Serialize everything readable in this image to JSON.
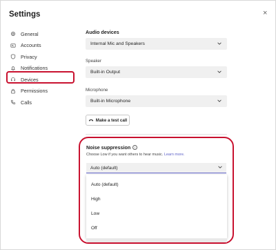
{
  "title": "Settings",
  "close_glyph": "×",
  "nav": [
    {
      "label": "General",
      "icon": "gear-icon"
    },
    {
      "label": "Accounts",
      "icon": "id-card-icon"
    },
    {
      "label": "Privacy",
      "icon": "shield-icon"
    },
    {
      "label": "Notifications",
      "icon": "bell-icon"
    },
    {
      "label": "Devices",
      "icon": "headset-icon"
    },
    {
      "label": "Permissions",
      "icon": "lock-icon"
    },
    {
      "label": "Calls",
      "icon": "phone-icon"
    }
  ],
  "audio": {
    "heading": "Audio devices",
    "device": "Internal Mic and Speakers",
    "speaker_label": "Speaker",
    "speaker": "Built-in Output",
    "mic_label": "Microphone",
    "mic": "Built-in Microphone",
    "test_call": "Make a test call"
  },
  "noise": {
    "heading": "Noise suppression",
    "info_glyph": "i",
    "description": "Choose Low if you want others to hear music.",
    "learn_more": "Learn more.",
    "selected": "Auto (default)",
    "options": [
      "Auto (default)",
      "High",
      "Low",
      "Off"
    ]
  },
  "colors": {
    "annotation": "#c8102e",
    "accent": "#5b5fc7"
  }
}
